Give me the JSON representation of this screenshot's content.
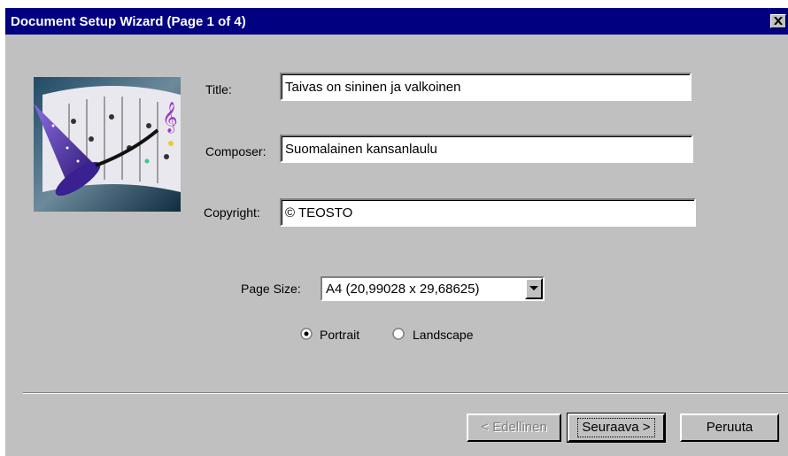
{
  "window": {
    "title": "Document Setup Wizard (Page 1 of 4)"
  },
  "form": {
    "title_label": "Title:",
    "title_value": "Taivas on sininen ja valkoinen",
    "composer_label": "Composer:",
    "composer_value": "Suomalainen kansanlaulu",
    "copyright_label": "Copyright:",
    "copyright_value": "© TEOSTO",
    "page_size_label": "Page Size:",
    "page_size_value": "A4 (20,99028 x 29,68625)",
    "orientation": {
      "portrait_label": "Portrait",
      "landscape_label": "Landscape",
      "selected": "Portrait"
    }
  },
  "buttons": {
    "back_label": "< Edellinen",
    "next_label": "Seuraava >",
    "cancel_label": "Peruuta"
  },
  "icons": [
    "close-icon",
    "wizard-hat-music-graphic",
    "dropdown-arrow-icon",
    "radio-icon"
  ]
}
